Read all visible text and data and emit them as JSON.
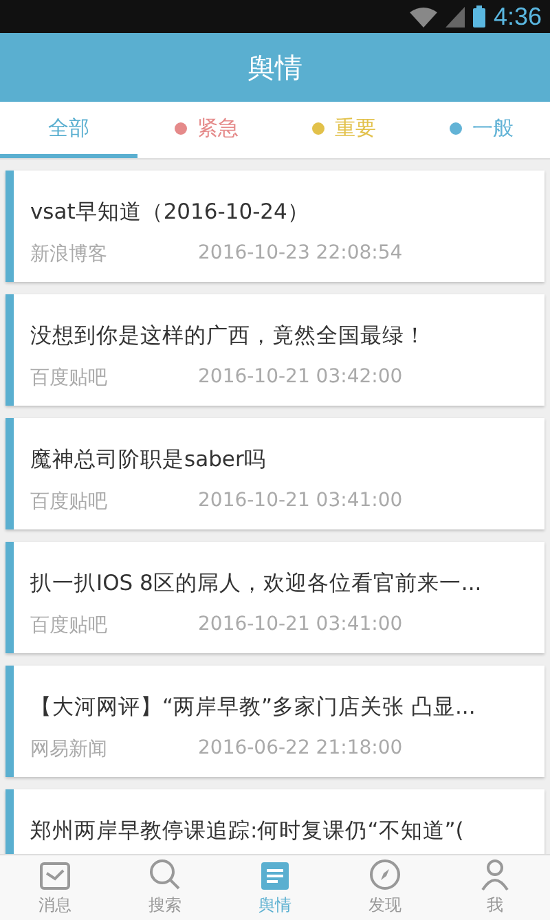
{
  "status_bar": {
    "time": "4:36"
  },
  "header": {
    "title": "舆情"
  },
  "tabs": [
    {
      "label": "全部",
      "selected": true
    },
    {
      "label": "紧急",
      "selected": false,
      "color": "#e58a8a"
    },
    {
      "label": "重要",
      "selected": false,
      "color": "#e2c14a"
    },
    {
      "label": "一般",
      "selected": false,
      "color": "#62b3d6"
    }
  ],
  "items": [
    {
      "title": "vsat早知道（2016-10-24）",
      "source": "新浪博客",
      "time": "2016-10-23 22:08:54"
    },
    {
      "title": "没想到你是这样的广西，竟然全国最绿！",
      "source": "百度贴吧",
      "time": "2016-10-21 03:42:00"
    },
    {
      "title": "魔神总司阶职是saber吗",
      "source": "百度贴吧",
      "time": "2016-10-21 03:41:00"
    },
    {
      "title": "扒一扒IOS 8区的屌人，欢迎各位看官前来一...",
      "source": "百度贴吧",
      "time": "2016-10-21 03:41:00"
    },
    {
      "title": "【大河网评】“两岸早教”多家门店关张 凸显...",
      "source": "网易新闻",
      "time": "2016-06-22 21:18:00"
    },
    {
      "title": "郑州两岸早教停课追踪:何时复课仍“不知道”("
    }
  ],
  "nav": [
    {
      "label": "消息",
      "selected": false
    },
    {
      "label": "搜索",
      "selected": false
    },
    {
      "label": "舆情",
      "selected": true
    },
    {
      "label": "发现",
      "selected": false
    },
    {
      "label": "我",
      "selected": false
    }
  ]
}
